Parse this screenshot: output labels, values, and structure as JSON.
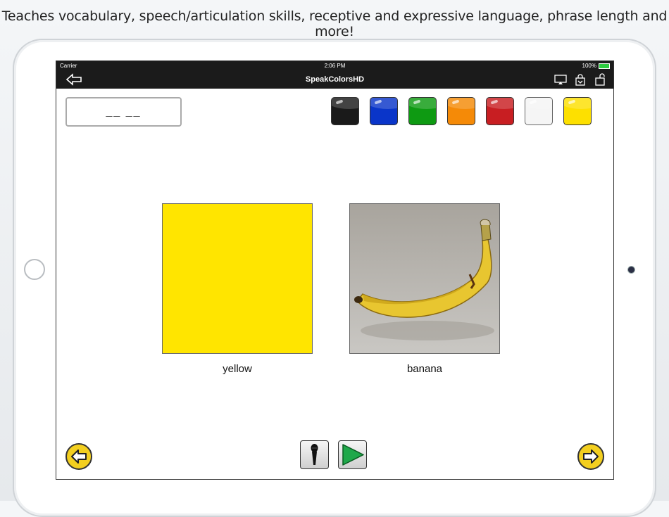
{
  "headline": "Teaches vocabulary, speech/articulation skills, receptive and expressive language, phrase length and more!",
  "statusbar": {
    "carrier": "Carrier",
    "time": "2:06 PM",
    "battery": "100%"
  },
  "navbar": {
    "title": "SpeakColorsHD"
  },
  "answer_box": {
    "value": "__ __"
  },
  "swatches": [
    {
      "name": "black",
      "color": "#1a1a1a"
    },
    {
      "name": "blue",
      "color": "#0a35c9"
    },
    {
      "name": "green",
      "color": "#0e9a12"
    },
    {
      "name": "orange",
      "color": "#f58a07"
    },
    {
      "name": "red",
      "color": "#c81e22"
    },
    {
      "name": "white",
      "color": "#f5f5f5"
    },
    {
      "name": "yellow",
      "color": "#fde000"
    }
  ],
  "cards": [
    {
      "label": "yellow",
      "color": "#ffe500"
    },
    {
      "label": "banana"
    }
  ],
  "icons": [
    "back-arrow-icon",
    "airplay-icon",
    "share-lock-icon",
    "unlock-icon",
    "microphone-icon",
    "play-icon",
    "left-arrow-icon",
    "right-arrow-icon"
  ]
}
